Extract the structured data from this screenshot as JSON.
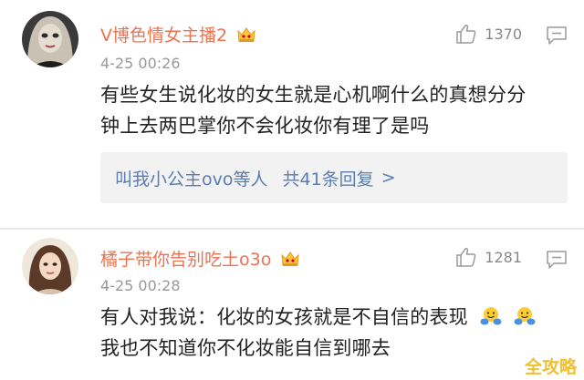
{
  "comments": [
    {
      "username": "V博色情女主播2",
      "badge_icon": "crown-badge-icon",
      "timestamp": "4-25 00:26",
      "likes": "1370",
      "text_lines": [
        "有些女生说化妆的女生就是心机啊什么的真想分分",
        "钟上去两巴掌你不会化妆你有理了是吗"
      ],
      "replies": {
        "who": "叫我小公主ovo等人",
        "count_text": "共41条回复",
        "arrow": ">"
      }
    },
    {
      "username": "橘子带你告别吃土o3o",
      "badge_icon": "crown-badge-icon",
      "timestamp": "4-25 00:28",
      "likes": "1281",
      "text_lines": [
        "有人对我说：化妆的女孩就是不自信的表现",
        "我也不知道你不化妆能自信到哪去"
      ],
      "emojis": [
        "hug-emoji-icon",
        "hug-emoji-icon"
      ]
    }
  ],
  "watermark": "全攻略",
  "colors": {
    "username": "#eb7350",
    "link": "#5a7db1",
    "meta": "#999999",
    "watermark": "#f0c030"
  }
}
